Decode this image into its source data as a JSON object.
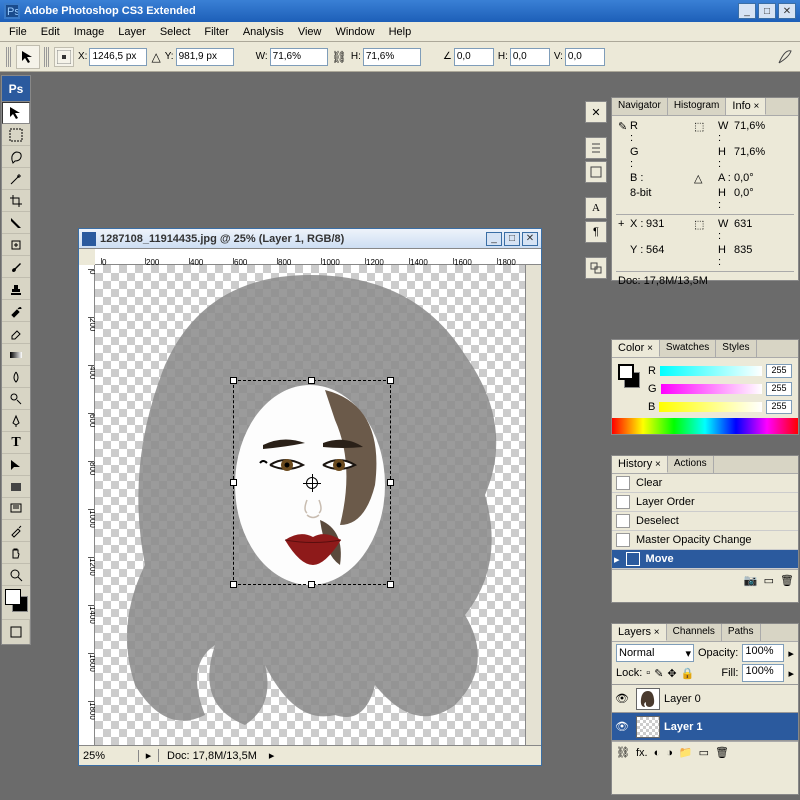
{
  "window": {
    "title": "Adobe Photoshop CS3 Extended"
  },
  "menu": {
    "items": [
      "File",
      "Edit",
      "Image",
      "Layer",
      "Select",
      "Filter",
      "Analysis",
      "View",
      "Window",
      "Help"
    ]
  },
  "options": {
    "x_label": "X:",
    "x": "1246,5 px",
    "y_label": "Y:",
    "y": "981,9 px",
    "w_label": "W:",
    "w": "71,6%",
    "h_label": "H:",
    "h": "71,6%",
    "angle_label": "∠",
    "angle": "0,0",
    "hskew_label": "H:",
    "hskew": "0,0",
    "vskew_label": "V:",
    "vskew": "0,0"
  },
  "document": {
    "title": "1287108_11914435.jpg @ 25% (Layer 1, RGB/8)",
    "zoom": "25%",
    "status": "Doc: 17,8M/13,5M",
    "ruler_h": [
      "0",
      "200",
      "400",
      "600",
      "800",
      "1000",
      "1200",
      "1400",
      "1600",
      "1800"
    ],
    "ruler_v": [
      "0",
      "200",
      "400",
      "600",
      "800",
      "1000",
      "1200",
      "1400",
      "1600",
      "1800"
    ]
  },
  "info_panel": {
    "tabs": [
      "Navigator",
      "Histogram",
      "Info"
    ],
    "r": "R :",
    "g": "G :",
    "b": "B :",
    "bit": "8-bit",
    "w": "W :",
    "w_val": "71,6%",
    "h": "H :",
    "h_val": "71,6%",
    "a": "A :",
    "a_val": "0,0°",
    "hh": "H :",
    "hh_val": "0,0°",
    "x": "X :",
    "x_val": "931",
    "y": "Y :",
    "y_val": "564",
    "ww": "W :",
    "ww_val": "631",
    "hhh": "H :",
    "hhh_val": "835",
    "doc": "Doc: 17,8M/13,5M"
  },
  "color_panel": {
    "tabs": [
      "Color",
      "Swatches",
      "Styles"
    ],
    "r": "R",
    "r_val": "255",
    "g": "G",
    "g_val": "255",
    "b": "B",
    "b_val": "255"
  },
  "history_panel": {
    "tabs": [
      "History",
      "Actions"
    ],
    "items": [
      "Clear",
      "Layer Order",
      "Deselect",
      "Master Opacity Change",
      "Move"
    ]
  },
  "layers_panel": {
    "tabs": [
      "Layers",
      "Channels",
      "Paths"
    ],
    "blend": "Normal",
    "opacity_label": "Opacity:",
    "opacity": "100%",
    "lock_label": "Lock:",
    "fill_label": "Fill:",
    "fill": "100%",
    "layers": [
      "Layer 0",
      "Layer 1"
    ]
  }
}
